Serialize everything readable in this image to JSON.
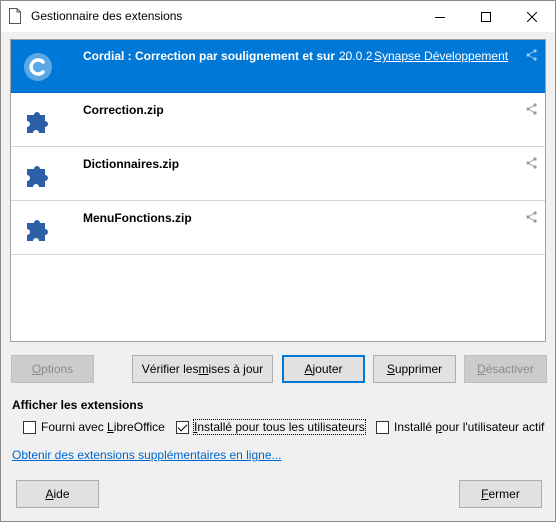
{
  "window": {
    "title": "Gestionnaire des extensions",
    "minimize_icon": "minimize-icon",
    "maximize_icon": "maximize-icon",
    "close_icon": "close-icon"
  },
  "extensions": [
    {
      "name": "Cordial : Correction par soulignement et sur ...",
      "version": "20.0.2",
      "publisher": "Synapse Développement",
      "icon": "cordial-logo-icon",
      "selected": true
    },
    {
      "name": "Correction.zip",
      "version": "",
      "publisher": "",
      "icon": "puzzle-piece-icon",
      "selected": false
    },
    {
      "name": "Dictionnaires.zip",
      "version": "",
      "publisher": "",
      "icon": "puzzle-piece-icon",
      "selected": false
    },
    {
      "name": "MenuFonctions.zip",
      "version": "",
      "publisher": "",
      "icon": "puzzle-piece-icon",
      "selected": false
    }
  ],
  "buttons": {
    "options": {
      "before": "",
      "key": "O",
      "after": "ptions"
    },
    "check_updates": {
      "before": "Vérifier les ",
      "key": "m",
      "after": "ises à jour"
    },
    "add": {
      "before": "",
      "key": "A",
      "after": "jouter"
    },
    "remove": {
      "before": "",
      "key": "S",
      "after": "upprimer"
    },
    "disable": {
      "before": "",
      "key": "D",
      "after": "ésactiver"
    },
    "help": {
      "before": "",
      "key": "A",
      "after": "ide"
    },
    "close": {
      "before": "",
      "key": "F",
      "after": "ermer"
    }
  },
  "filter": {
    "heading": "Afficher les extensions",
    "bundled": {
      "before": "Fourni avec ",
      "key": "L",
      "after": "ibreOffice",
      "checked": false
    },
    "shared": {
      "before": "",
      "key": "I",
      "after": "nstallé pour tous les utilisateurs",
      "checked": true
    },
    "user": {
      "before": "Installé ",
      "key": "p",
      "after": "our l'utilisateur actif",
      "checked": false
    }
  },
  "more_extensions_link": "Obtenir des extensions supplémentaires en ligne...",
  "colors": {
    "selection": "#0078d7",
    "link": "#0066cc",
    "puzzle_icon": "#2d5fa6"
  }
}
